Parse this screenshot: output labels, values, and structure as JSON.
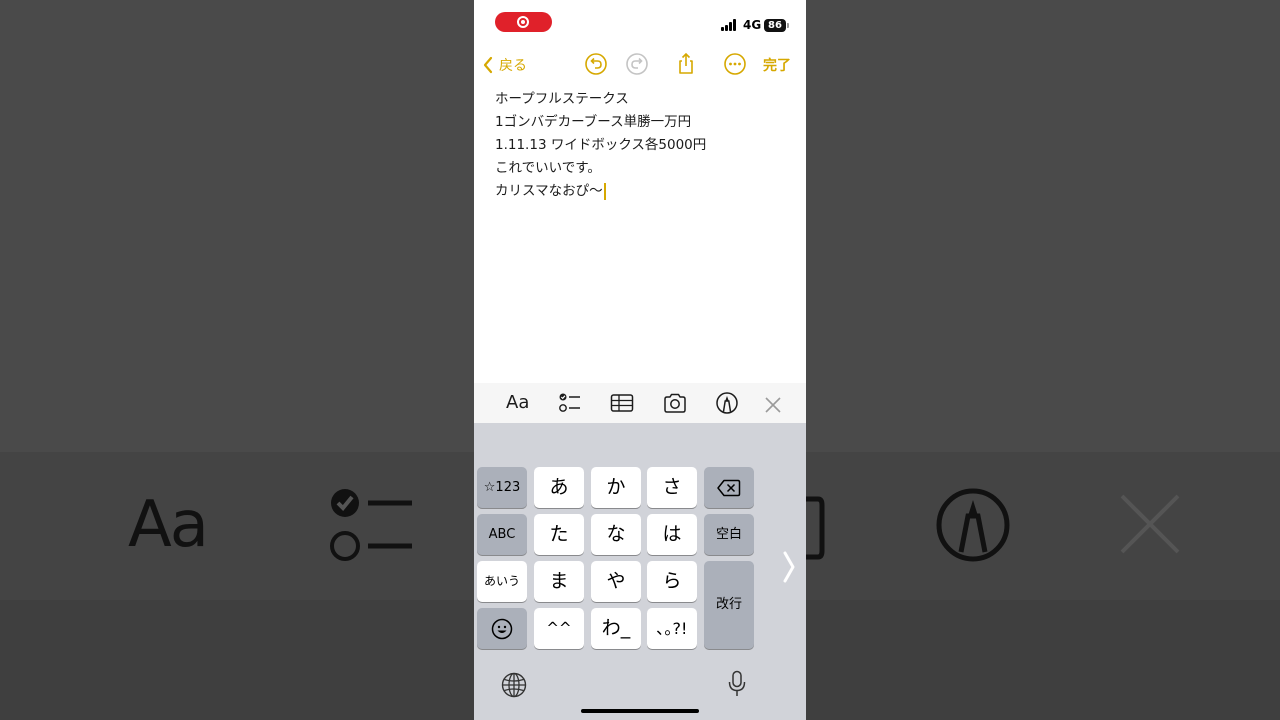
{
  "status_bar": {
    "network": "4G",
    "battery": "86"
  },
  "nav": {
    "back_label": "戻る",
    "done_label": "完了"
  },
  "note": {
    "lines": [
      "ホープフルステークス",
      "1ゴンバデカーブース単勝一万円",
      "1.11.13 ワイドボックス各5000円",
      "これでいいです。",
      "カリスマなおぴ〜"
    ]
  },
  "format_toolbar": {
    "text_style_label": "Aa",
    "icons": [
      "checklist-icon",
      "table-icon",
      "camera-icon",
      "markup-icon",
      "close-icon"
    ]
  },
  "keyboard": {
    "left_column": [
      "☆123",
      "ABC",
      "あいう",
      "emoji"
    ],
    "rows": [
      [
        "あ",
        "か",
        "さ"
      ],
      [
        "た",
        "な",
        "は"
      ],
      [
        "ま",
        "や",
        "ら"
      ],
      [
        "^^",
        "わ_",
        "､｡?!"
      ]
    ],
    "space_label": "空白",
    "return_label": "改行"
  },
  "background": {
    "aa_label": "Aa"
  },
  "colors": {
    "accent": "#d6a800",
    "record": "#e0212a",
    "keyboard_bg": "#d1d3d9"
  }
}
